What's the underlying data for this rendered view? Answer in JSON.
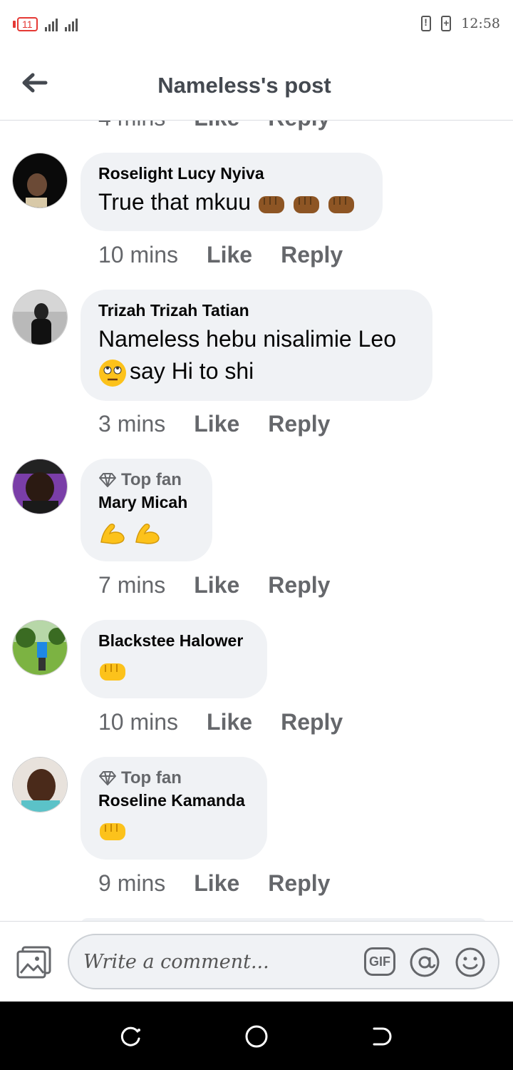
{
  "status_bar": {
    "notification_count": "11",
    "time": "12:58"
  },
  "header": {
    "title": "Nameless's post"
  },
  "partial_row": {
    "time": "4 mins",
    "like": "Like",
    "reply": "Reply"
  },
  "comments": [
    {
      "author": "Roselight Lucy Nyiva",
      "text": "True that mkuu",
      "emoji": [
        "oncoming-fist-dark",
        "oncoming-fist-dark",
        "oncoming-fist-dark"
      ],
      "time": "10 mins",
      "like": "Like",
      "reply": "Reply"
    },
    {
      "author": "Trizah Trizah Tatian",
      "text_line1": "Nameless hebu nisalimie Leo",
      "text_line2": "say Hi to shi",
      "emoji": [
        "face-with-rolling-eyes"
      ],
      "time": "3 mins",
      "like": "Like",
      "reply": "Reply"
    },
    {
      "badge": "Top fan",
      "author": "Mary Micah",
      "emoji": [
        "flexed-biceps",
        "flexed-biceps"
      ],
      "time": "7 mins",
      "like": "Like",
      "reply": "Reply"
    },
    {
      "author": "Blackstee Halower",
      "emoji": [
        "oncoming-fist"
      ],
      "time": "10 mins",
      "like": "Like",
      "reply": "Reply"
    },
    {
      "badge": "Top fan",
      "author": "Roseline Kamanda",
      "emoji": [
        "oncoming-fist"
      ],
      "time": "9 mins",
      "like": "Like",
      "reply": "Reply"
    }
  ],
  "composer": {
    "placeholder": "Write a comment...",
    "gif_label": "GIF"
  },
  "icons": {
    "back": "arrow-left-icon",
    "photo": "photo-icon",
    "mention": "at-icon",
    "emoji": "smile-icon",
    "badge": "diamond-icon"
  }
}
